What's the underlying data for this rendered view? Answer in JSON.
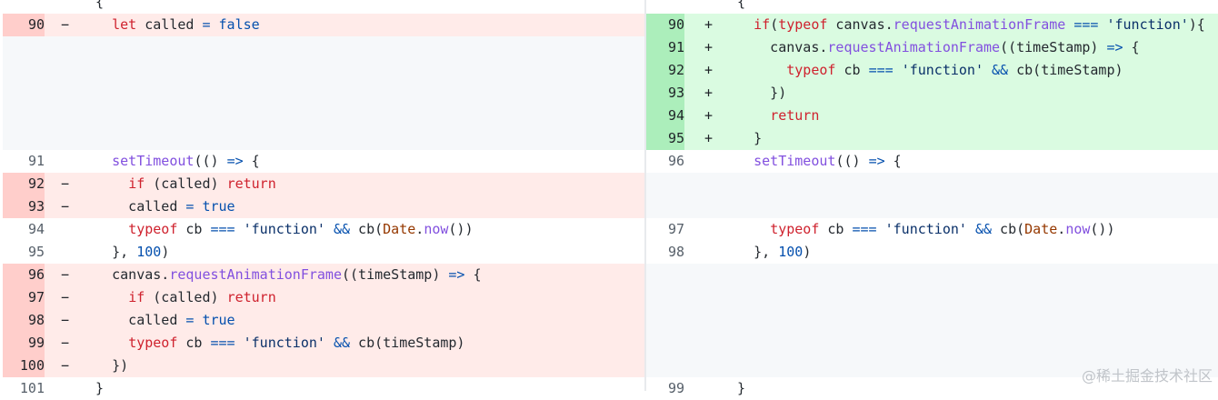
{
  "left": {
    "rows": [
      {
        "type": "ctx",
        "num": "",
        "sign": "",
        "code": [
          {
            "c": "",
            "t": "  {"
          }
        ]
      },
      {
        "type": "del",
        "num": "90",
        "sign": "−",
        "code": [
          {
            "c": "",
            "t": "    "
          },
          {
            "c": "kw",
            "t": "let"
          },
          {
            "c": "",
            "t": " called "
          },
          {
            "c": "bl",
            "t": "="
          },
          {
            "c": "",
            "t": " "
          },
          {
            "c": "bl",
            "t": "false"
          }
        ]
      },
      {
        "type": "empty",
        "num": "",
        "sign": "",
        "code": []
      },
      {
        "type": "empty",
        "num": "",
        "sign": "",
        "code": []
      },
      {
        "type": "empty",
        "num": "",
        "sign": "",
        "code": []
      },
      {
        "type": "empty",
        "num": "",
        "sign": "",
        "code": []
      },
      {
        "type": "empty",
        "num": "",
        "sign": "",
        "code": []
      },
      {
        "type": "ctx",
        "num": "91",
        "sign": "",
        "code": [
          {
            "c": "",
            "t": "    "
          },
          {
            "c": "fn",
            "t": "setTimeout"
          },
          {
            "c": "",
            "t": "(() "
          },
          {
            "c": "bl",
            "t": "=>"
          },
          {
            "c": "",
            "t": " {"
          }
        ]
      },
      {
        "type": "del",
        "num": "92",
        "sign": "−",
        "code": [
          {
            "c": "",
            "t": "      "
          },
          {
            "c": "kw",
            "t": "if"
          },
          {
            "c": "",
            "t": " (called) "
          },
          {
            "c": "kw",
            "t": "return"
          }
        ]
      },
      {
        "type": "del",
        "num": "93",
        "sign": "−",
        "code": [
          {
            "c": "",
            "t": "      called "
          },
          {
            "c": "bl",
            "t": "="
          },
          {
            "c": "",
            "t": " "
          },
          {
            "c": "bl",
            "t": "true"
          }
        ]
      },
      {
        "type": "ctx",
        "num": "94",
        "sign": "",
        "code": [
          {
            "c": "",
            "t": "      "
          },
          {
            "c": "kw",
            "t": "typeof"
          },
          {
            "c": "",
            "t": " cb "
          },
          {
            "c": "bl",
            "t": "==="
          },
          {
            "c": "",
            "t": " "
          },
          {
            "c": "st",
            "t": "'function'"
          },
          {
            "c": "",
            "t": " "
          },
          {
            "c": "bl",
            "t": "&&"
          },
          {
            "c": "",
            "t": " cb("
          },
          {
            "c": "or",
            "t": "Date"
          },
          {
            "c": "",
            "t": "."
          },
          {
            "c": "fn",
            "t": "now"
          },
          {
            "c": "",
            "t": "())"
          }
        ]
      },
      {
        "type": "ctx",
        "num": "95",
        "sign": "",
        "code": [
          {
            "c": "",
            "t": "    }, "
          },
          {
            "c": "bl",
            "t": "100"
          },
          {
            "c": "",
            "t": ")"
          }
        ]
      },
      {
        "type": "del",
        "num": "96",
        "sign": "−",
        "code": [
          {
            "c": "",
            "t": "    canvas."
          },
          {
            "c": "fn",
            "t": "requestAnimationFrame"
          },
          {
            "c": "",
            "t": "((timeStamp) "
          },
          {
            "c": "bl",
            "t": "=>"
          },
          {
            "c": "",
            "t": " {"
          }
        ]
      },
      {
        "type": "del",
        "num": "97",
        "sign": "−",
        "code": [
          {
            "c": "",
            "t": "      "
          },
          {
            "c": "kw",
            "t": "if"
          },
          {
            "c": "",
            "t": " (called) "
          },
          {
            "c": "kw",
            "t": "return"
          }
        ]
      },
      {
        "type": "del",
        "num": "98",
        "sign": "−",
        "code": [
          {
            "c": "",
            "t": "      called "
          },
          {
            "c": "bl",
            "t": "="
          },
          {
            "c": "",
            "t": " "
          },
          {
            "c": "bl",
            "t": "true"
          }
        ]
      },
      {
        "type": "del",
        "num": "99",
        "sign": "−",
        "code": [
          {
            "c": "",
            "t": "      "
          },
          {
            "c": "kw",
            "t": "typeof"
          },
          {
            "c": "",
            "t": " cb "
          },
          {
            "c": "bl",
            "t": "==="
          },
          {
            "c": "",
            "t": " "
          },
          {
            "c": "st",
            "t": "'function'"
          },
          {
            "c": "",
            "t": " "
          },
          {
            "c": "bl",
            "t": "&&"
          },
          {
            "c": "",
            "t": " cb(timeStamp)"
          }
        ]
      },
      {
        "type": "del",
        "num": "100",
        "sign": "−",
        "code": [
          {
            "c": "",
            "t": "    })"
          }
        ]
      },
      {
        "type": "ctx",
        "num": "101",
        "sign": "",
        "code": [
          {
            "c": "",
            "t": "  }"
          }
        ]
      }
    ]
  },
  "right": {
    "rows": [
      {
        "type": "ctx",
        "num": "",
        "sign": "",
        "code": [
          {
            "c": "",
            "t": "  {"
          }
        ]
      },
      {
        "type": "add",
        "num": "90",
        "sign": "+",
        "code": [
          {
            "c": "",
            "t": "    "
          },
          {
            "c": "kw",
            "t": "if"
          },
          {
            "c": "",
            "t": "("
          },
          {
            "c": "kw",
            "t": "typeof"
          },
          {
            "c": "",
            "t": " canvas."
          },
          {
            "c": "fn",
            "t": "requestAnimationFrame"
          },
          {
            "c": "",
            "t": " "
          },
          {
            "c": "bl",
            "t": "==="
          },
          {
            "c": "",
            "t": " "
          },
          {
            "c": "st",
            "t": "'function'"
          },
          {
            "c": "",
            "t": "){"
          }
        ]
      },
      {
        "type": "add",
        "num": "91",
        "sign": "+",
        "code": [
          {
            "c": "",
            "t": "      canvas."
          },
          {
            "c": "fn",
            "t": "requestAnimationFrame"
          },
          {
            "c": "",
            "t": "((timeStamp) "
          },
          {
            "c": "bl",
            "t": "=>"
          },
          {
            "c": "",
            "t": " {"
          }
        ]
      },
      {
        "type": "add",
        "num": "92",
        "sign": "+",
        "code": [
          {
            "c": "",
            "t": "        "
          },
          {
            "c": "kw",
            "t": "typeof"
          },
          {
            "c": "",
            "t": " cb "
          },
          {
            "c": "bl",
            "t": "==="
          },
          {
            "c": "",
            "t": " "
          },
          {
            "c": "st",
            "t": "'function'"
          },
          {
            "c": "",
            "t": " "
          },
          {
            "c": "bl",
            "t": "&&"
          },
          {
            "c": "",
            "t": " cb(timeStamp)"
          }
        ]
      },
      {
        "type": "add",
        "num": "93",
        "sign": "+",
        "code": [
          {
            "c": "",
            "t": "      })"
          }
        ]
      },
      {
        "type": "add",
        "num": "94",
        "sign": "+",
        "code": [
          {
            "c": "",
            "t": "      "
          },
          {
            "c": "kw",
            "t": "return"
          }
        ]
      },
      {
        "type": "add",
        "num": "95",
        "sign": "+",
        "code": [
          {
            "c": "",
            "t": "    }"
          }
        ]
      },
      {
        "type": "ctx",
        "num": "96",
        "sign": "",
        "code": [
          {
            "c": "",
            "t": "    "
          },
          {
            "c": "fn",
            "t": "setTimeout"
          },
          {
            "c": "",
            "t": "(() "
          },
          {
            "c": "bl",
            "t": "=>"
          },
          {
            "c": "",
            "t": " {"
          }
        ]
      },
      {
        "type": "empty",
        "num": "",
        "sign": "",
        "code": []
      },
      {
        "type": "empty",
        "num": "",
        "sign": "",
        "code": []
      },
      {
        "type": "ctx",
        "num": "97",
        "sign": "",
        "code": [
          {
            "c": "",
            "t": "      "
          },
          {
            "c": "kw",
            "t": "typeof"
          },
          {
            "c": "",
            "t": " cb "
          },
          {
            "c": "bl",
            "t": "==="
          },
          {
            "c": "",
            "t": " "
          },
          {
            "c": "st",
            "t": "'function'"
          },
          {
            "c": "",
            "t": " "
          },
          {
            "c": "bl",
            "t": "&&"
          },
          {
            "c": "",
            "t": " cb("
          },
          {
            "c": "or",
            "t": "Date"
          },
          {
            "c": "",
            "t": "."
          },
          {
            "c": "fn",
            "t": "now"
          },
          {
            "c": "",
            "t": "())"
          }
        ]
      },
      {
        "type": "ctx",
        "num": "98",
        "sign": "",
        "code": [
          {
            "c": "",
            "t": "    }, "
          },
          {
            "c": "bl",
            "t": "100"
          },
          {
            "c": "",
            "t": ")"
          }
        ]
      },
      {
        "type": "empty",
        "num": "",
        "sign": "",
        "code": []
      },
      {
        "type": "empty",
        "num": "",
        "sign": "",
        "code": []
      },
      {
        "type": "empty",
        "num": "",
        "sign": "",
        "code": []
      },
      {
        "type": "empty",
        "num": "",
        "sign": "",
        "code": []
      },
      {
        "type": "empty",
        "num": "",
        "sign": "",
        "code": []
      },
      {
        "type": "ctx",
        "num": "99",
        "sign": "",
        "code": [
          {
            "c": "",
            "t": "  }"
          }
        ]
      }
    ]
  },
  "watermark": "@稀土掘金技术社区"
}
